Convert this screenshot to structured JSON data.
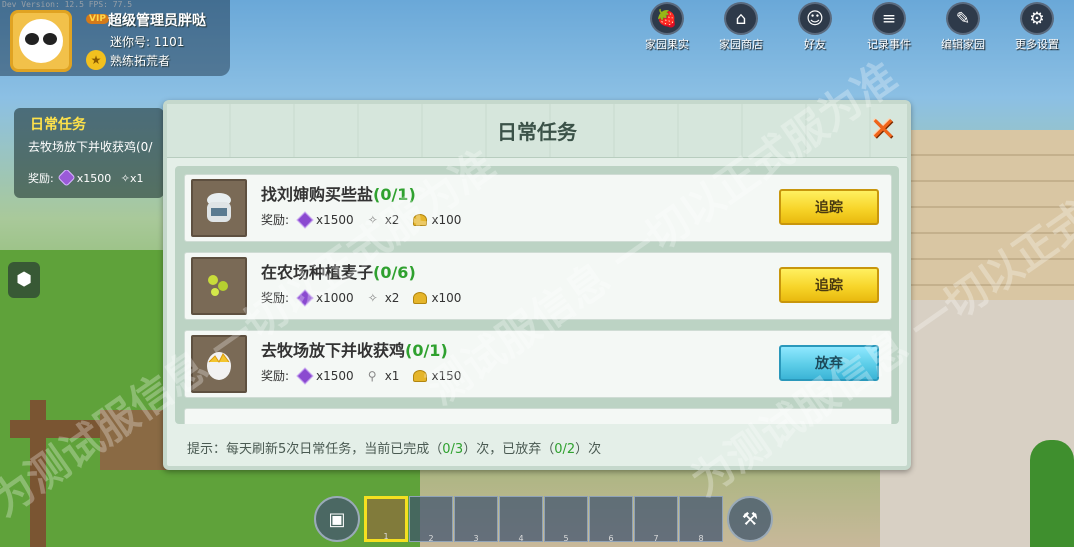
{
  "dev_version": "Dev Version: 12.5  FPS: 77.5",
  "player": {
    "vip": "VIP",
    "name": "超级管理员胖哒",
    "id_text": "迷你号: 1101",
    "title": "熟练拓荒者"
  },
  "top_menu": [
    {
      "label": "家园果实",
      "icon": "fruit-icon",
      "glyph": "🍓"
    },
    {
      "label": "家园商店",
      "icon": "shop-icon",
      "glyph": "⌂"
    },
    {
      "label": "好友",
      "icon": "friends-icon",
      "glyph": "☺"
    },
    {
      "label": "记录事件",
      "icon": "record-icon",
      "glyph": "≡"
    },
    {
      "label": "编辑家园",
      "icon": "edit-icon",
      "glyph": "✎"
    },
    {
      "label": "更多设置",
      "icon": "settings-icon",
      "glyph": "⚙"
    }
  ],
  "side_task": {
    "title": "日常任务",
    "desc": "去牧场放下并收获鸡(0/",
    "reward_label": "奖励:",
    "reward_gem": "x1500",
    "reward_extra": "x1"
  },
  "dialog": {
    "title": "日常任务",
    "close_glyph": "✕",
    "tasks": [
      {
        "name": "找刘婶购买些盐",
        "progress": "(0/1)",
        "reward_label": "奖励:",
        "rewards": [
          "x1500",
          "x2",
          "x100"
        ],
        "button": "追踪",
        "button_type": "track"
      },
      {
        "name": "在农场种植麦子",
        "progress": "(0/6)",
        "reward_label": "奖励:",
        "rewards": [
          "x1000",
          "x2",
          "x100"
        ],
        "button": "追踪",
        "button_type": "track"
      },
      {
        "name": "去牧场放下并收获鸡",
        "progress": "(0/1)",
        "reward_label": "奖励:",
        "rewards": [
          "x1500",
          "x1",
          "x150"
        ],
        "button": "放弃",
        "button_type": "abandon"
      }
    ],
    "tip_prefix": "提示：每天刷新5次日常任务，当前已完成（",
    "tip_done": "0/3",
    "tip_mid": "）次，已放弃（",
    "tip_abandoned": "0/2",
    "tip_suffix": "）次"
  },
  "hotbar": {
    "slots": [
      "1",
      "2",
      "3",
      "4",
      "5",
      "6",
      "7",
      "8"
    ]
  },
  "watermarks": [
    "为测试服信息 一切以正式服为准",
    "测试服信息 一切以正式服为准",
    "为测试服信息 一切以正式服为准"
  ],
  "colors": {
    "progress_green": "#2fa12f",
    "track_button": "#f7d52a",
    "abandon_button": "#5ccde8",
    "close_orange": "#f0641a"
  }
}
